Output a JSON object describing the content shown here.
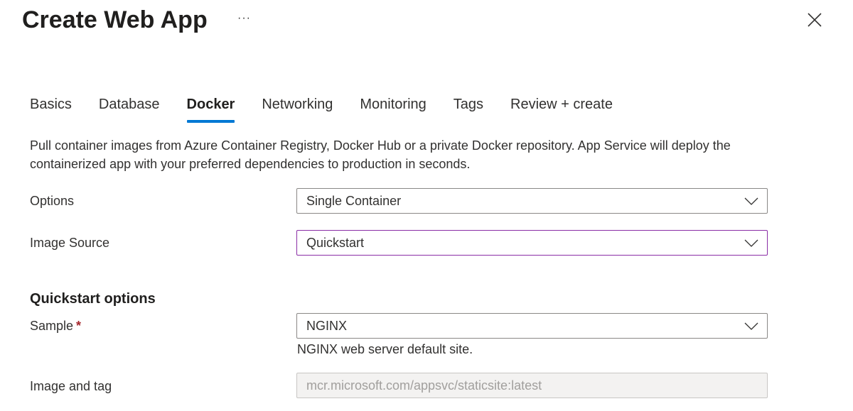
{
  "header": {
    "title": "Create Web App",
    "more_label": "···",
    "close_icon": "close-icon"
  },
  "tabs": [
    {
      "label": "Basics",
      "active": false
    },
    {
      "label": "Database",
      "active": false
    },
    {
      "label": "Docker",
      "active": true
    },
    {
      "label": "Networking",
      "active": false
    },
    {
      "label": "Monitoring",
      "active": false
    },
    {
      "label": "Tags",
      "active": false
    },
    {
      "label": "Review + create",
      "active": false
    }
  ],
  "description": "Pull container images from Azure Container Registry, Docker Hub or a private Docker repository. App Service will deploy the containerized app with your preferred dependencies to production in seconds.",
  "form": {
    "options": {
      "label": "Options",
      "value": "Single Container"
    },
    "image_source": {
      "label": "Image Source",
      "value": "Quickstart"
    },
    "quickstart_heading": "Quickstart options",
    "sample": {
      "label": "Sample",
      "required_marker": "*",
      "value": "NGINX",
      "helper": "NGINX web server default site."
    },
    "image_and_tag": {
      "label": "Image and tag",
      "value": "mcr.microsoft.com/appsvc/staticsite:latest"
    }
  },
  "colors": {
    "accent": "#0078d4",
    "focus_border": "#8a2da5",
    "required": "#a4262c",
    "disabled_bg": "#f3f2f1"
  }
}
